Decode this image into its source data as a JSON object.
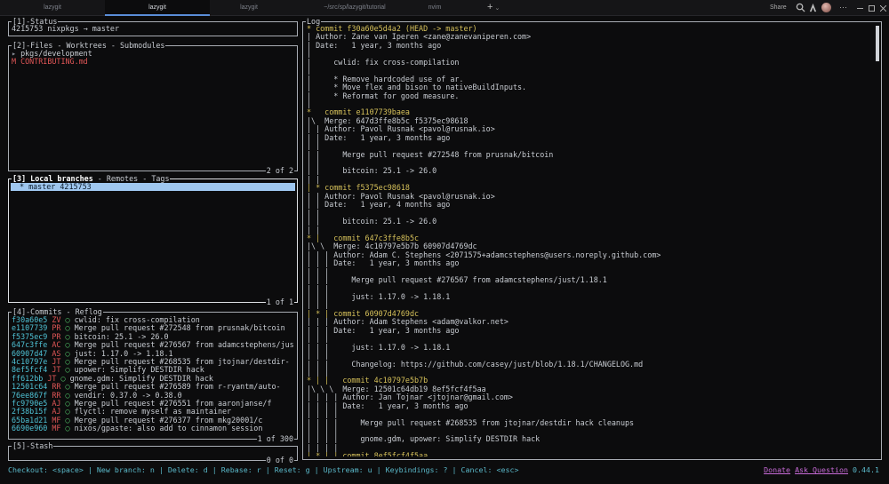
{
  "tabs": [
    {
      "label": "lazygit"
    },
    {
      "label": "lazygit"
    },
    {
      "label": "lazygit"
    },
    {
      "label": "~/src/sp/lazygit/tutorial"
    },
    {
      "label": "nvim"
    }
  ],
  "new_tab": {
    "label": "+",
    "chevron": "⌄"
  },
  "share_label": "Share",
  "menu_dots": "⋯",
  "status_pane": {
    "title": "[1]-Status",
    "content": "4215753 nixpkgs → master"
  },
  "files_pane": {
    "title": "[2]-Files - Worktrees - Submodules",
    "rows": [
      {
        "mark": "▸",
        "name": "pkgs/development"
      },
      {
        "mark": "M",
        "name": "CONTRIBUTING.md"
      }
    ],
    "footer": "2 of 2"
  },
  "branches_pane": {
    "title_bold": "[3] Local branches",
    "title_rest": " - Remotes - Tags",
    "rows": [
      {
        "text": "* master 4215753"
      }
    ],
    "footer": "1 of 1"
  },
  "commits_pane": {
    "title": "[4]-Commits - Reflog",
    "rows": [
      {
        "sha": "f30a60e5",
        "author": "ZV",
        "graph": "◯",
        "msg": "cwlid: fix cross-compilation"
      },
      {
        "sha": "e1107739",
        "author": "PR",
        "graph": "◯",
        "msg": "Merge pull request #272548 from prusnak/bitcoin"
      },
      {
        "sha": "f5375ec9",
        "author": "PR",
        "graph": "◯",
        "msg": "bitcoin: 25.1 -> 26.0"
      },
      {
        "sha": "647c3ffe",
        "author": "AC",
        "graph": "◯",
        "msg": "Merge pull request #276567 from adamcstephens/just"
      },
      {
        "sha": "60907d47",
        "author": "AS",
        "graph": "◯",
        "msg": "just: 1.17.0 -> 1.18.1"
      },
      {
        "sha": "4c10797e",
        "author": "JT",
        "graph": "◯",
        "msg": "Merge pull request #268535 from jtojnar/destdir-"
      },
      {
        "sha": "8ef5fcf4",
        "author": "JT",
        "graph": "◯",
        "msg": "upower: Simplify DESTDIR hack"
      },
      {
        "sha": "ff612bb",
        "author": "JT",
        "graph": "◯",
        "msg": "gnome.gdm: Simplify DESTDIR hack"
      },
      {
        "sha": "12501c64",
        "author": "RR",
        "graph": "◯",
        "msg": "Merge pull request #276589 from r-ryantm/auto-"
      },
      {
        "sha": "76ee867f",
        "author": "RR",
        "graph": "◯",
        "msg": "vendir: 0.37.0 -> 0.38.0"
      },
      {
        "sha": "fc9790e5",
        "author": "AJ",
        "graph": "◯",
        "msg": "Merge pull request #276551 from aaronjanse/f"
      },
      {
        "sha": "2f38b15f",
        "author": "AJ",
        "graph": "◯",
        "msg": "flyctl: remove myself as maintainer"
      },
      {
        "sha": "65ba1d21",
        "author": "MF",
        "graph": "◯",
        "msg": "Merge pull request #276377 from mkg20001/c"
      },
      {
        "sha": "6690e960",
        "author": "MF",
        "graph": "◯",
        "msg": "nixos/gpaste: also add to cinnamon session"
      }
    ],
    "footer": "1 of 300"
  },
  "stash_pane": {
    "title": "[5]-Stash",
    "footer": "0 of 0"
  },
  "log_pane": {
    "title": "Log",
    "lines": [
      "* commit f30a60e5d4a2 (HEAD -> master)",
      "| Author: Zane van Iperen <zane@zanevaniperen.com>",
      "| Date:   1 year, 3 months ago",
      "|",
      "|     cwlid: fix cross-compilation",
      "|",
      "|     * Remove hardcoded use of ar.",
      "|     * Move flex and bison to nativeBuildInputs.",
      "|     * Reformat for good measure.",
      "|",
      "*   commit e1107739baea",
      "|\\  Merge: 647d3ffe8b5c f5375ec98618",
      "| | Author: Pavol Rusnak <pavol@rusnak.io>",
      "| | Date:   1 year, 3 months ago",
      "| |",
      "| |     Merge pull request #272548 from prusnak/bitcoin",
      "| |",
      "| |     bitcoin: 25.1 -> 26.0",
      "| |",
      "| * commit f5375ec98618",
      "| | Author: Pavol Rusnak <pavol@rusnak.io>",
      "| | Date:   1 year, 4 months ago",
      "| |",
      "| |     bitcoin: 25.1 -> 26.0",
      "| |",
      "* |   commit 647c3ffe8b5c",
      "|\\ \\  Merge: 4c10797e5b7b 60907d4769dc",
      "| | | Author: Adam C. Stephens <2071575+adamcstephens@users.noreply.github.com>",
      "| | | Date:   1 year, 3 months ago",
      "| | |",
      "| | |     Merge pull request #276567 from adamcstephens/just/1.18.1",
      "| | |",
      "| | |     just: 1.17.0 -> 1.18.1",
      "| | |",
      "| * | commit 60907d4769dc",
      "| | | Author: Adam Stephens <adam@valkor.net>",
      "| | | Date:   1 year, 3 months ago",
      "| | |",
      "| | |     just: 1.17.0 -> 1.18.1",
      "| | |",
      "| | |     Changelog: https://github.com/casey/just/blob/1.18.1/CHANGELOG.md",
      "| | |",
      "* | |   commit 4c10797e5b7b",
      "|\\ \\ \\  Merge: 12501c64db19 8ef5fcf4f5aa",
      "| | | | Author: Jan Tojnar <jtojnar@gmail.com>",
      "| | | | Date:   1 year, 3 months ago",
      "| | | |",
      "| | | |     Merge pull request #268535 from jtojnar/destdir hack cleanups",
      "| | | |",
      "| | | |     gnome.gdm, upower: Simplify DESTDIR hack",
      "| | | |",
      "| * | | commit 8ef5fcf4f5aa"
    ]
  },
  "status_bar": {
    "keybindings": "Checkout: <space> | New branch: n | Delete: d | Rebase: r | Reset: g | Upstream: u | Keybindings: ? | Cancel: <esc>",
    "donate": "Donate",
    "ask": "Ask Question",
    "version": "0.44.1"
  },
  "colors": {
    "accent": "#5ab8c9",
    "selected_bg": "#9fc7ef",
    "link": "#c66ad6",
    "sha": "#d6c15a",
    "author_initials": "#e05656",
    "graph": "#53c96a"
  }
}
